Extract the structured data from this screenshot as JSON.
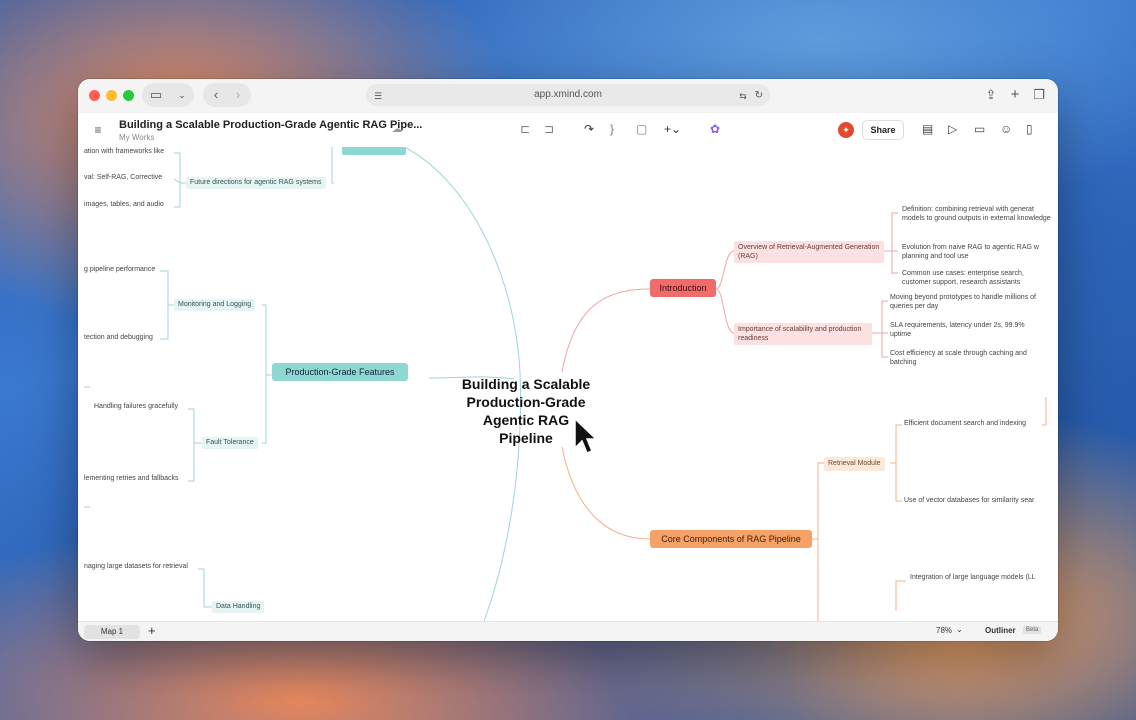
{
  "browser": {
    "url": "app.xmind.com"
  },
  "app": {
    "doc_title": "Building a Scalable Production-Grade Agentic RAG Pipe...",
    "doc_subtitle": "My Works",
    "share_label": "Share"
  },
  "mindmap": {
    "central": [
      "Building a Scalable",
      "Production-Grade",
      "Agentic RAG",
      "Pipeline"
    ],
    "introduction": {
      "label": "Introduction",
      "overview": {
        "label": "Overview of Retrieval-Augmented Generation (RAG)",
        "children": [
          "Definition: combining retrieval with generat models to ground outputs in external knowledge",
          "Evolution from naive RAG to agentic RAG w planning and tool use",
          "Common use cases: enterprise search, customer support, research assistants"
        ]
      },
      "importance": {
        "label": "Importance of scalability and production readiness",
        "children": [
          "Moving beyond prototypes to handle millions of queries per day",
          "SLA requirements, latency under 2s, 99.9% uptime",
          "Cost efficiency at scale through caching and batching"
        ]
      }
    },
    "core": {
      "label": "Core Components of RAG Pipeline",
      "retrieval": {
        "label": "Retrieval Module",
        "children": [
          "Efficient document search and indexing",
          "Use of vector databases for similarity sear"
        ]
      },
      "llm_child": "Integration of large language models (LL"
    },
    "production": {
      "label": "Production-Grade Features",
      "monitoring": {
        "label": "Monitoring and Logging",
        "children": [
          "g pipeline performance",
          "tection and debugging"
        ]
      },
      "fault": {
        "label": "Fault Tolerance",
        "children": [
          "Handling failures gracefully",
          "lementing retries and fallbacks"
        ]
      },
      "data": {
        "label": "Data Handling",
        "children": [
          "naging large datasets for retrieval"
        ]
      }
    },
    "future": {
      "label": "Future directions for agentic RAG systems",
      "children": [
        "ation with frameworks like",
        "val: Self-RAG, Corrective",
        "images, tables, and audio"
      ]
    }
  },
  "bottom": {
    "map_tab": "Map 1",
    "add_label": "+",
    "zoom": "78%",
    "outliner": "Outliner",
    "beta": "Beta"
  },
  "colors": {
    "intro": "#f26b6b",
    "core": "#f6a165",
    "production": "#8ed8d3",
    "line_teal": "#9fd3dc",
    "line_red": "#f0a3a3",
    "line_orange": "#f4b08a"
  }
}
